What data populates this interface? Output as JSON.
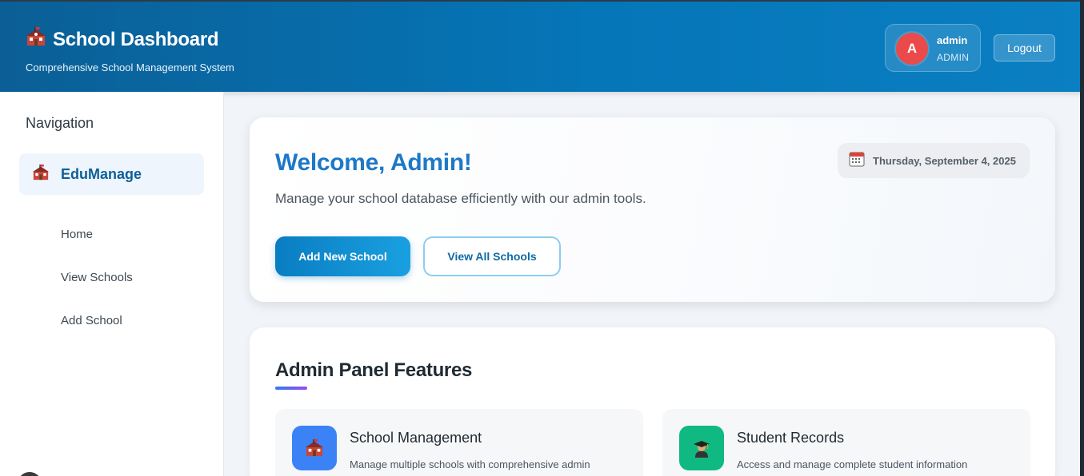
{
  "header": {
    "title": "School Dashboard",
    "subtitle": "Comprehensive School Management System",
    "user": {
      "initial": "A",
      "name": "admin",
      "role": "ADMIN"
    },
    "logout_label": "Logout"
  },
  "sidebar": {
    "heading": "Navigation",
    "brand": "EduManage",
    "items": [
      {
        "label": "Home"
      },
      {
        "label": "View Schools"
      },
      {
        "label": "Add School"
      }
    ]
  },
  "welcome": {
    "title": "Welcome, Admin!",
    "date": "Thursday, September 4, 2025",
    "description": "Manage your school database efficiently with our admin tools.",
    "primary_button": "Add New School",
    "secondary_button": "View All Schools"
  },
  "features": {
    "title": "Admin Panel Features",
    "cards": [
      {
        "title": "School Management",
        "description": "Manage multiple schools with comprehensive admin",
        "icon": "school-icon",
        "color": "#3b82f6"
      },
      {
        "title": "Student Records",
        "description": "Access and manage complete student information",
        "icon": "graduate-icon",
        "color": "#10b981"
      }
    ]
  },
  "colors": {
    "accent": "#0576b8",
    "welcome_title": "#1d78c7",
    "avatar": "#ea4a4a"
  }
}
